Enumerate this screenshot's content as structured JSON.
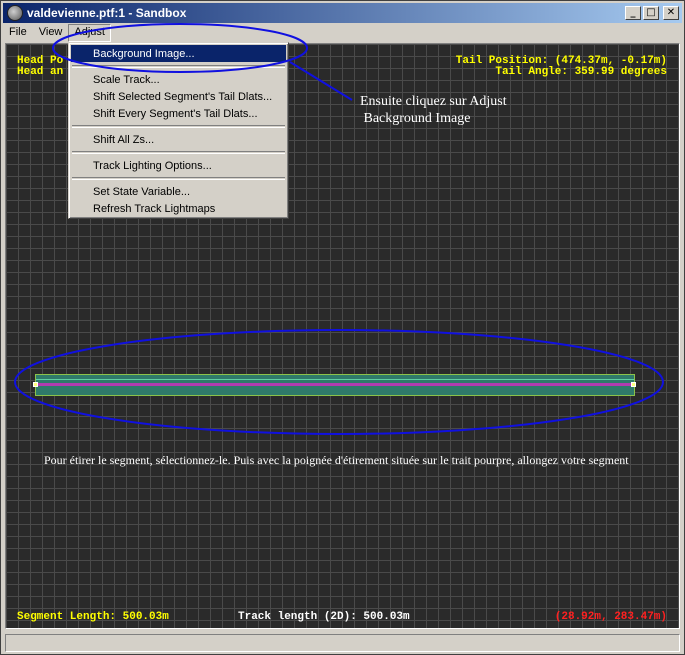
{
  "window": {
    "title": "valdevienne.ptf:1 - Sandbox",
    "minimize_glyph": "_",
    "maximize_glyph": "□",
    "close_glyph": "✕"
  },
  "menubar": {
    "items": [
      {
        "label": "File"
      },
      {
        "label": "View"
      },
      {
        "label": "Adjust"
      }
    ]
  },
  "adjust_menu": {
    "groups": [
      [
        "Background Image..."
      ],
      [
        "Scale Track...",
        "Shift Selected Segment's Tail Dlats...",
        "Shift Every Segment's Tail Dlats..."
      ],
      [
        "Shift All Zs..."
      ],
      [
        "Track Lighting Options..."
      ],
      [
        "Set State Variable...",
        "Refresh Track Lightmaps"
      ]
    ],
    "selected": "Background Image..."
  },
  "hud": {
    "head_pos": "Head Po",
    "head_angle": "Head an",
    "tail_position": "Tail Position: (474.37m, -0.17m)",
    "tail_angle": "Tail Angle: 359.99 degrees",
    "segment_length": "Segment Length: 500.03m",
    "track_length": "Track length (2D): 500.03m",
    "cursor_coords": "(28.92m, 283.47m)"
  },
  "annotations": {
    "adjust_note_line1": "Ensuite cliquez sur Adjust",
    "adjust_note_line2": " Background Image",
    "stretch_instructions": "Pour étirer le segment, sélectionnez-le. Puis avec la poignée d'étirement située sur le trait pourpre, allongez votre segment"
  },
  "colors": {
    "hud_text": "#ffff00",
    "annotation_ellipse": "#1010e0",
    "menu_highlight": "#0a246a",
    "track_fill": "#2f7a6a",
    "track_stripe": "#b23bb0",
    "cursor_coords": "#ff2020"
  }
}
